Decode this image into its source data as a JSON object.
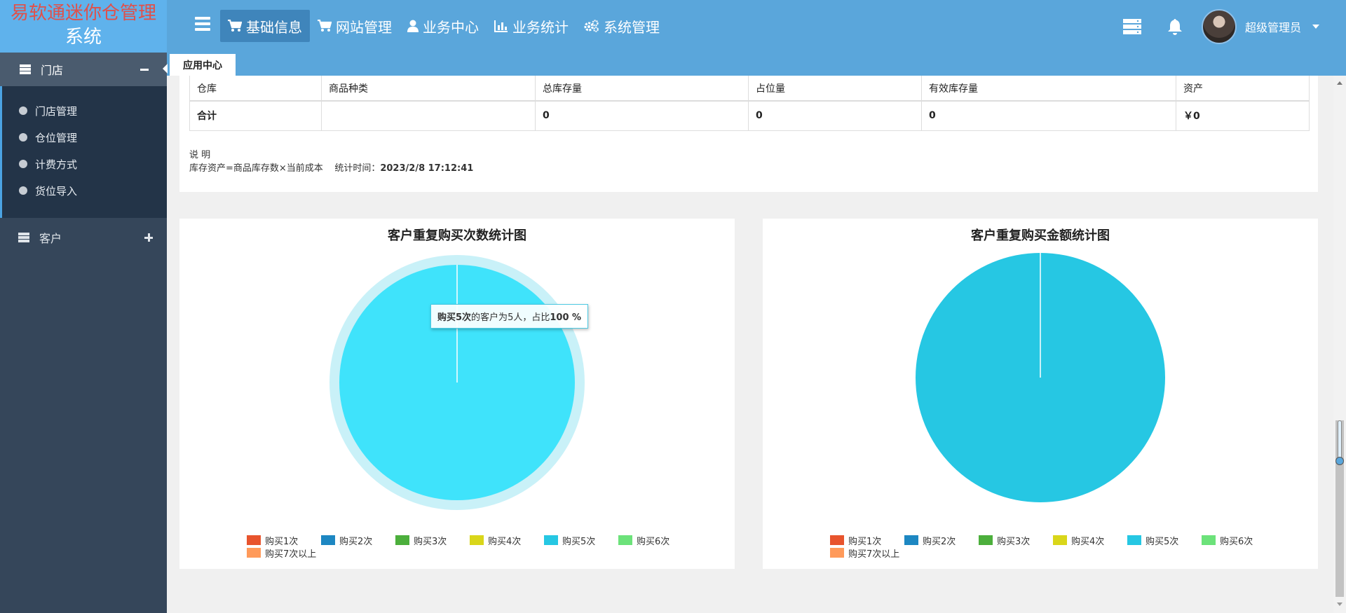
{
  "app": {
    "title_line1": "易软通迷你仓管理",
    "title_line2": "系统"
  },
  "topnav": {
    "items": [
      {
        "label": "基础信息",
        "icon": "cart-icon"
      },
      {
        "label": "网站管理",
        "icon": "cart-icon"
      },
      {
        "label": "业务中心",
        "icon": "user-icon"
      },
      {
        "label": "业务统计",
        "icon": "bar-chart-icon"
      },
      {
        "label": "系统管理",
        "icon": "gears-icon"
      }
    ],
    "active": "基础信息"
  },
  "user": {
    "name": "超级管理员"
  },
  "tabs": {
    "current": "应用中心"
  },
  "sidebar": {
    "store": {
      "label": "门店",
      "items": [
        {
          "label": "门店管理"
        },
        {
          "label": "仓位管理"
        },
        {
          "label": "计费方式"
        },
        {
          "label": "货位导入"
        }
      ]
    },
    "customer": {
      "label": "客户"
    }
  },
  "stock_table": {
    "headers": [
      "仓库",
      "商品种类",
      "总库存量",
      "占位量",
      "有效库存量",
      "资产"
    ],
    "total_row": [
      "合计",
      "",
      "0",
      "0",
      "0",
      "￥0"
    ]
  },
  "note": {
    "title": "说 明",
    "formula": "库存资产=商品库存数×当前成本",
    "time_label": "统计时间：",
    "time_value": "2023/2/8 17:12:41"
  },
  "chart_data": [
    {
      "type": "pie",
      "title": "客户重复购买次数统计图",
      "categories": [
        "购买1次",
        "购买2次",
        "购买3次",
        "购买4次",
        "购买5次",
        "购买6次",
        "购买7次以上"
      ],
      "values": [
        0,
        0,
        0,
        0,
        5,
        0,
        0
      ],
      "colors": [
        "#e8542d",
        "#1d87c2",
        "#4caf3c",
        "#d9d61a",
        "#26c7e3",
        "#6ce27a",
        "#ff9a5a"
      ],
      "highlighted": "购买5次",
      "tooltip": {
        "category": "购买5次",
        "mid1": "的客户为",
        "value": "5人",
        "mid2": "，占比",
        "percent": "100 %"
      }
    },
    {
      "type": "pie",
      "title": "客户重复购买金额统计图",
      "categories": [
        "购买1次",
        "购买2次",
        "购买3次",
        "购买4次",
        "购买5次",
        "购买6次",
        "购买7次以上"
      ],
      "values": [
        0,
        0,
        0,
        0,
        1,
        0,
        0
      ],
      "colors": [
        "#e8542d",
        "#1d87c2",
        "#4caf3c",
        "#d9d61a",
        "#26c7e3",
        "#6ce27a",
        "#ff9a5a"
      ]
    }
  ]
}
